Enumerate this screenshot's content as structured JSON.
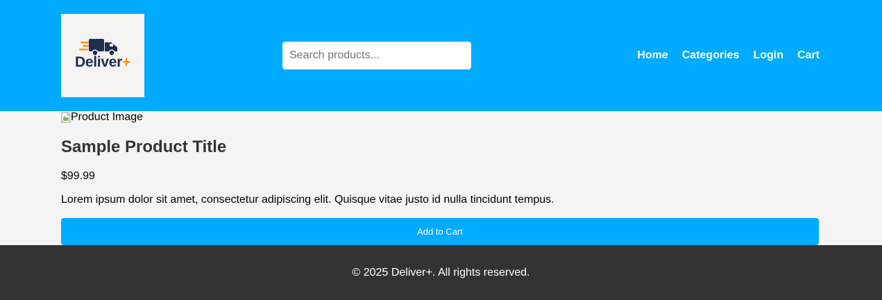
{
  "header": {
    "background_color": "#00aaff",
    "logo": {
      "text": "Deliver+",
      "text_color": "#1f2d4e",
      "plus_color": "#f7941d",
      "icon": "delivery-truck-icon"
    },
    "search": {
      "placeholder": "Search products...",
      "value": ""
    },
    "nav": {
      "home": "Home",
      "categories": "Categories",
      "login": "Login",
      "cart": "Cart"
    }
  },
  "product": {
    "image_alt": "Product Image",
    "title": "Sample Product Title",
    "price": "$99.99",
    "description": "Lorem ipsum dolor sit amet, consectetur adipiscing elit. Quisque vitae justo id nulla tincidunt tempus.",
    "add_to_cart_label": "Add to Cart",
    "button_color": "#00aaff"
  },
  "footer": {
    "text": "© 2025 Deliver+. All rights reserved.",
    "background_color": "#333333"
  }
}
